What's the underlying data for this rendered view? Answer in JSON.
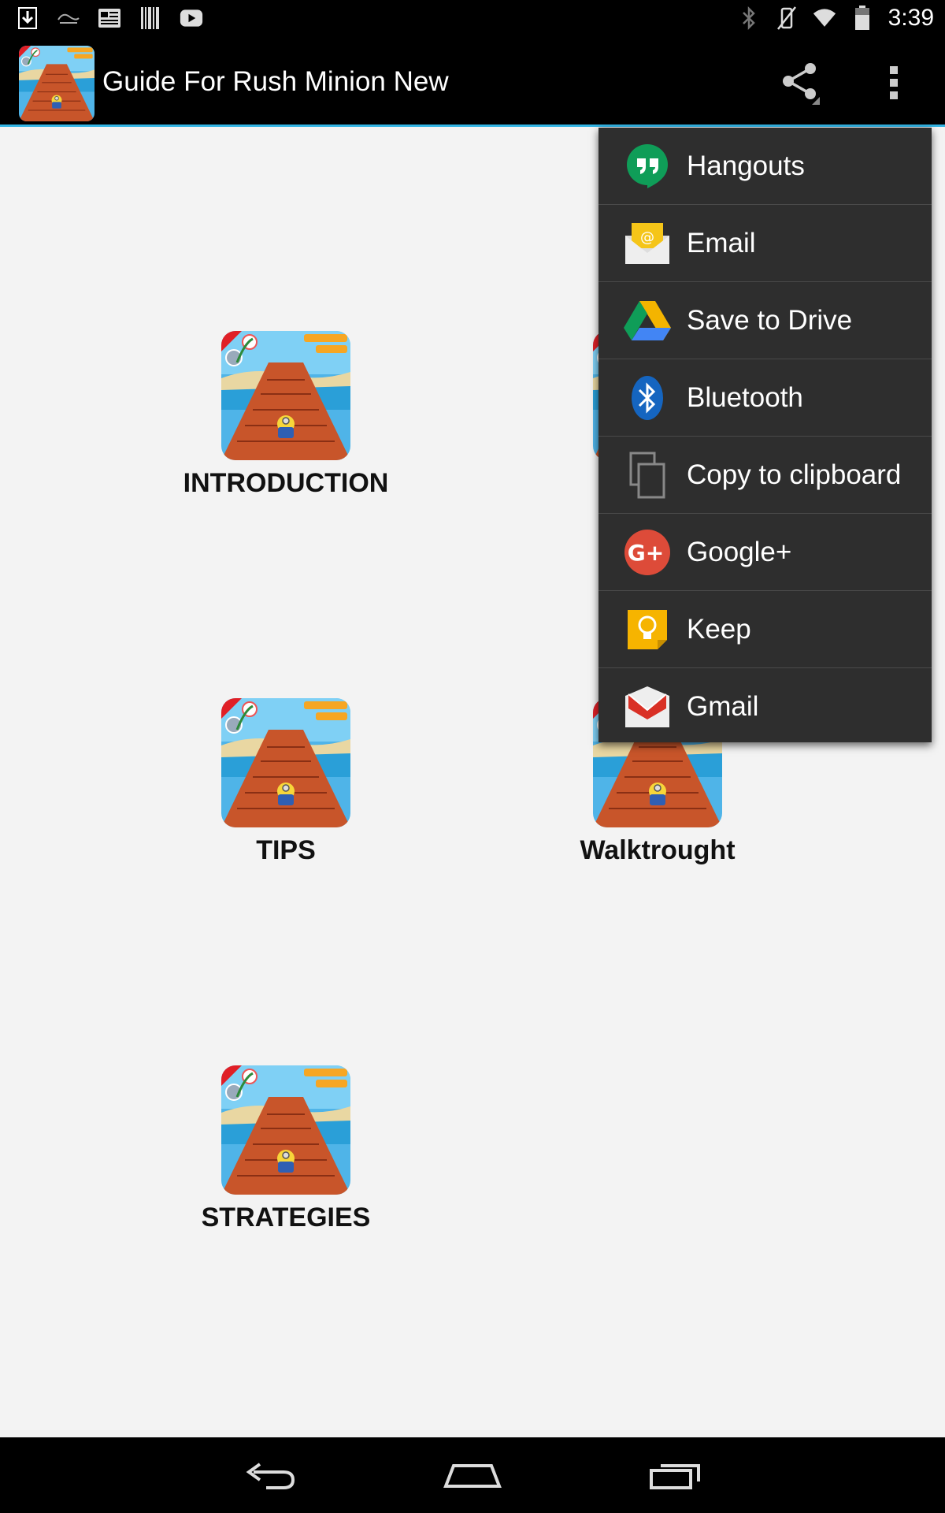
{
  "status_bar": {
    "time": "3:39",
    "left_icons": [
      "download-icon",
      "game-notification-icon",
      "news-icon",
      "barcode-icon",
      "youtube-icon"
    ],
    "right_icons": [
      "bluetooth-icon",
      "vibrate-icon",
      "wifi-icon",
      "battery-icon"
    ]
  },
  "action_bar": {
    "title": "Guide For Rush Minion New",
    "accent_color": "#33b5e5"
  },
  "tiles": [
    {
      "label": "INTRODUCTION"
    },
    {
      "label": "TIPS"
    },
    {
      "label": "Walktrought"
    },
    {
      "label": "STRATEGIES"
    }
  ],
  "share_menu": {
    "items": [
      {
        "label": "Hangouts",
        "icon": "hangouts-icon"
      },
      {
        "label": "Email",
        "icon": "email-icon"
      },
      {
        "label": "Save to Drive",
        "icon": "drive-icon"
      },
      {
        "label": "Bluetooth",
        "icon": "bluetooth-icon"
      },
      {
        "label": "Copy to clipboard",
        "icon": "clipboard-icon"
      },
      {
        "label": "Google+",
        "icon": "googleplus-icon"
      },
      {
        "label": "Keep",
        "icon": "keep-icon"
      },
      {
        "label": "Gmail",
        "icon": "gmail-icon"
      }
    ]
  },
  "nav_bar": {
    "buttons": [
      "back-icon",
      "home-icon",
      "recents-icon"
    ]
  }
}
